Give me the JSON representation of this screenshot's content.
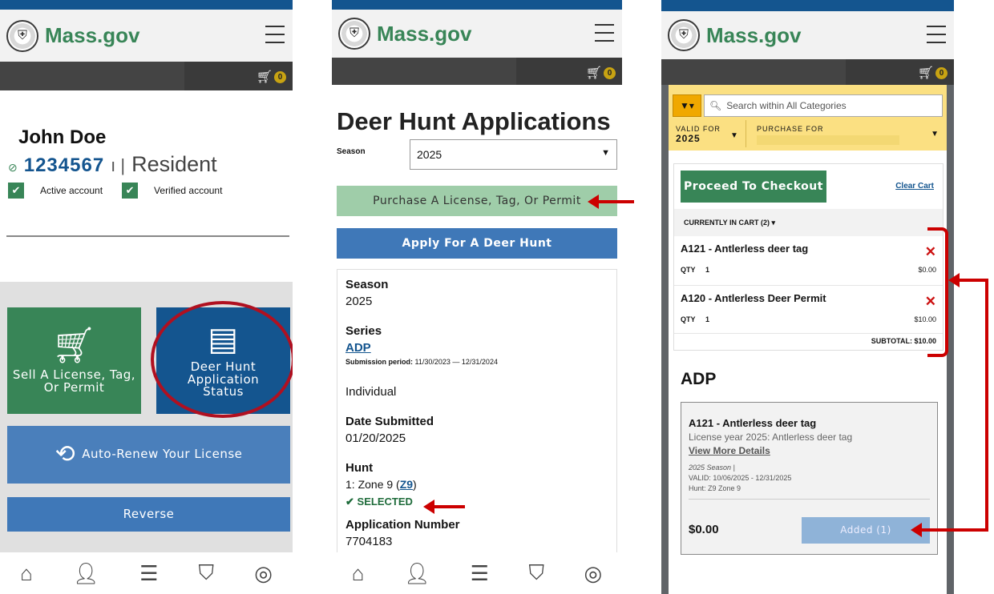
{
  "colors": {
    "brand": "#388557",
    "navy": "#14558f",
    "accent": "#c00",
    "gold": "#fbe082"
  },
  "app": {
    "logo_text": "Mass.gov",
    "cart_count": "0"
  },
  "screen1": {
    "name": "John Doe",
    "id_number": "1234567",
    "separator": "ı |",
    "residency": "Resident",
    "status_active": "Active account",
    "status_verified": "Verified account",
    "tiles": [
      {
        "label": "Sell A License, Tag, Or Permit",
        "icon": "cart-download-icon"
      },
      {
        "label": "Deer Hunt Application Status",
        "icon": "document-list-icon"
      }
    ],
    "auto_renew_label": "Auto-Renew Your License",
    "reverse_label": "Reverse"
  },
  "screen2": {
    "title": "Deer Hunt Applications",
    "season_label": "Season",
    "season_value": "2025",
    "purchase_btn": "Purchase A License, Tag, Or Permit",
    "apply_btn": "Apply For A Deer Hunt",
    "card": {
      "season_label": "Season",
      "season_value": "2025",
      "series_label": "Series",
      "series_value": "ADP",
      "submission_label": "Submission period:",
      "submission_value": "11/30/2023 — 12/31/2024",
      "type": "Individual",
      "date_label": "Date Submitted",
      "date_value": "01/20/2025",
      "hunt_label": "Hunt",
      "hunt_prefix": "1: Zone 9 (",
      "hunt_link": "Z9",
      "hunt_suffix": ")",
      "selected": "SELECTED",
      "appnum_label": "Application Number",
      "appnum_value": "7704183"
    }
  },
  "screen3": {
    "search_placeholder": "Search within All Categories",
    "valid_for_label": "VALID FOR",
    "valid_for_value": "2025",
    "purchase_for_label": "PURCHASE FOR",
    "checkout_btn": "Proceed To Checkout",
    "clear_cart": "Clear Cart",
    "in_cart": "CURRENTLY IN CART (2)",
    "qty_label": "QTY",
    "items": [
      {
        "name": "A121 - Antlerless deer tag",
        "qty": "1",
        "price": "$0.00"
      },
      {
        "name": "A120 - Antlerless Deer Permit",
        "qty": "1",
        "price": "$10.00"
      }
    ],
    "subtotal": "SUBTOTAL: $10.00",
    "section_title": "ADP",
    "product": {
      "name": "A121 - Antlerless deer tag",
      "desc": "License year 2025: Antlerless deer tag",
      "more": "View More Details",
      "season": "2025 Season  |",
      "valid": "VALID: 10/06/2025 - 12/31/2025",
      "hunt": "Hunt: Z9 Zone 9",
      "price": "$0.00",
      "added_btn": "Added (1)"
    }
  }
}
